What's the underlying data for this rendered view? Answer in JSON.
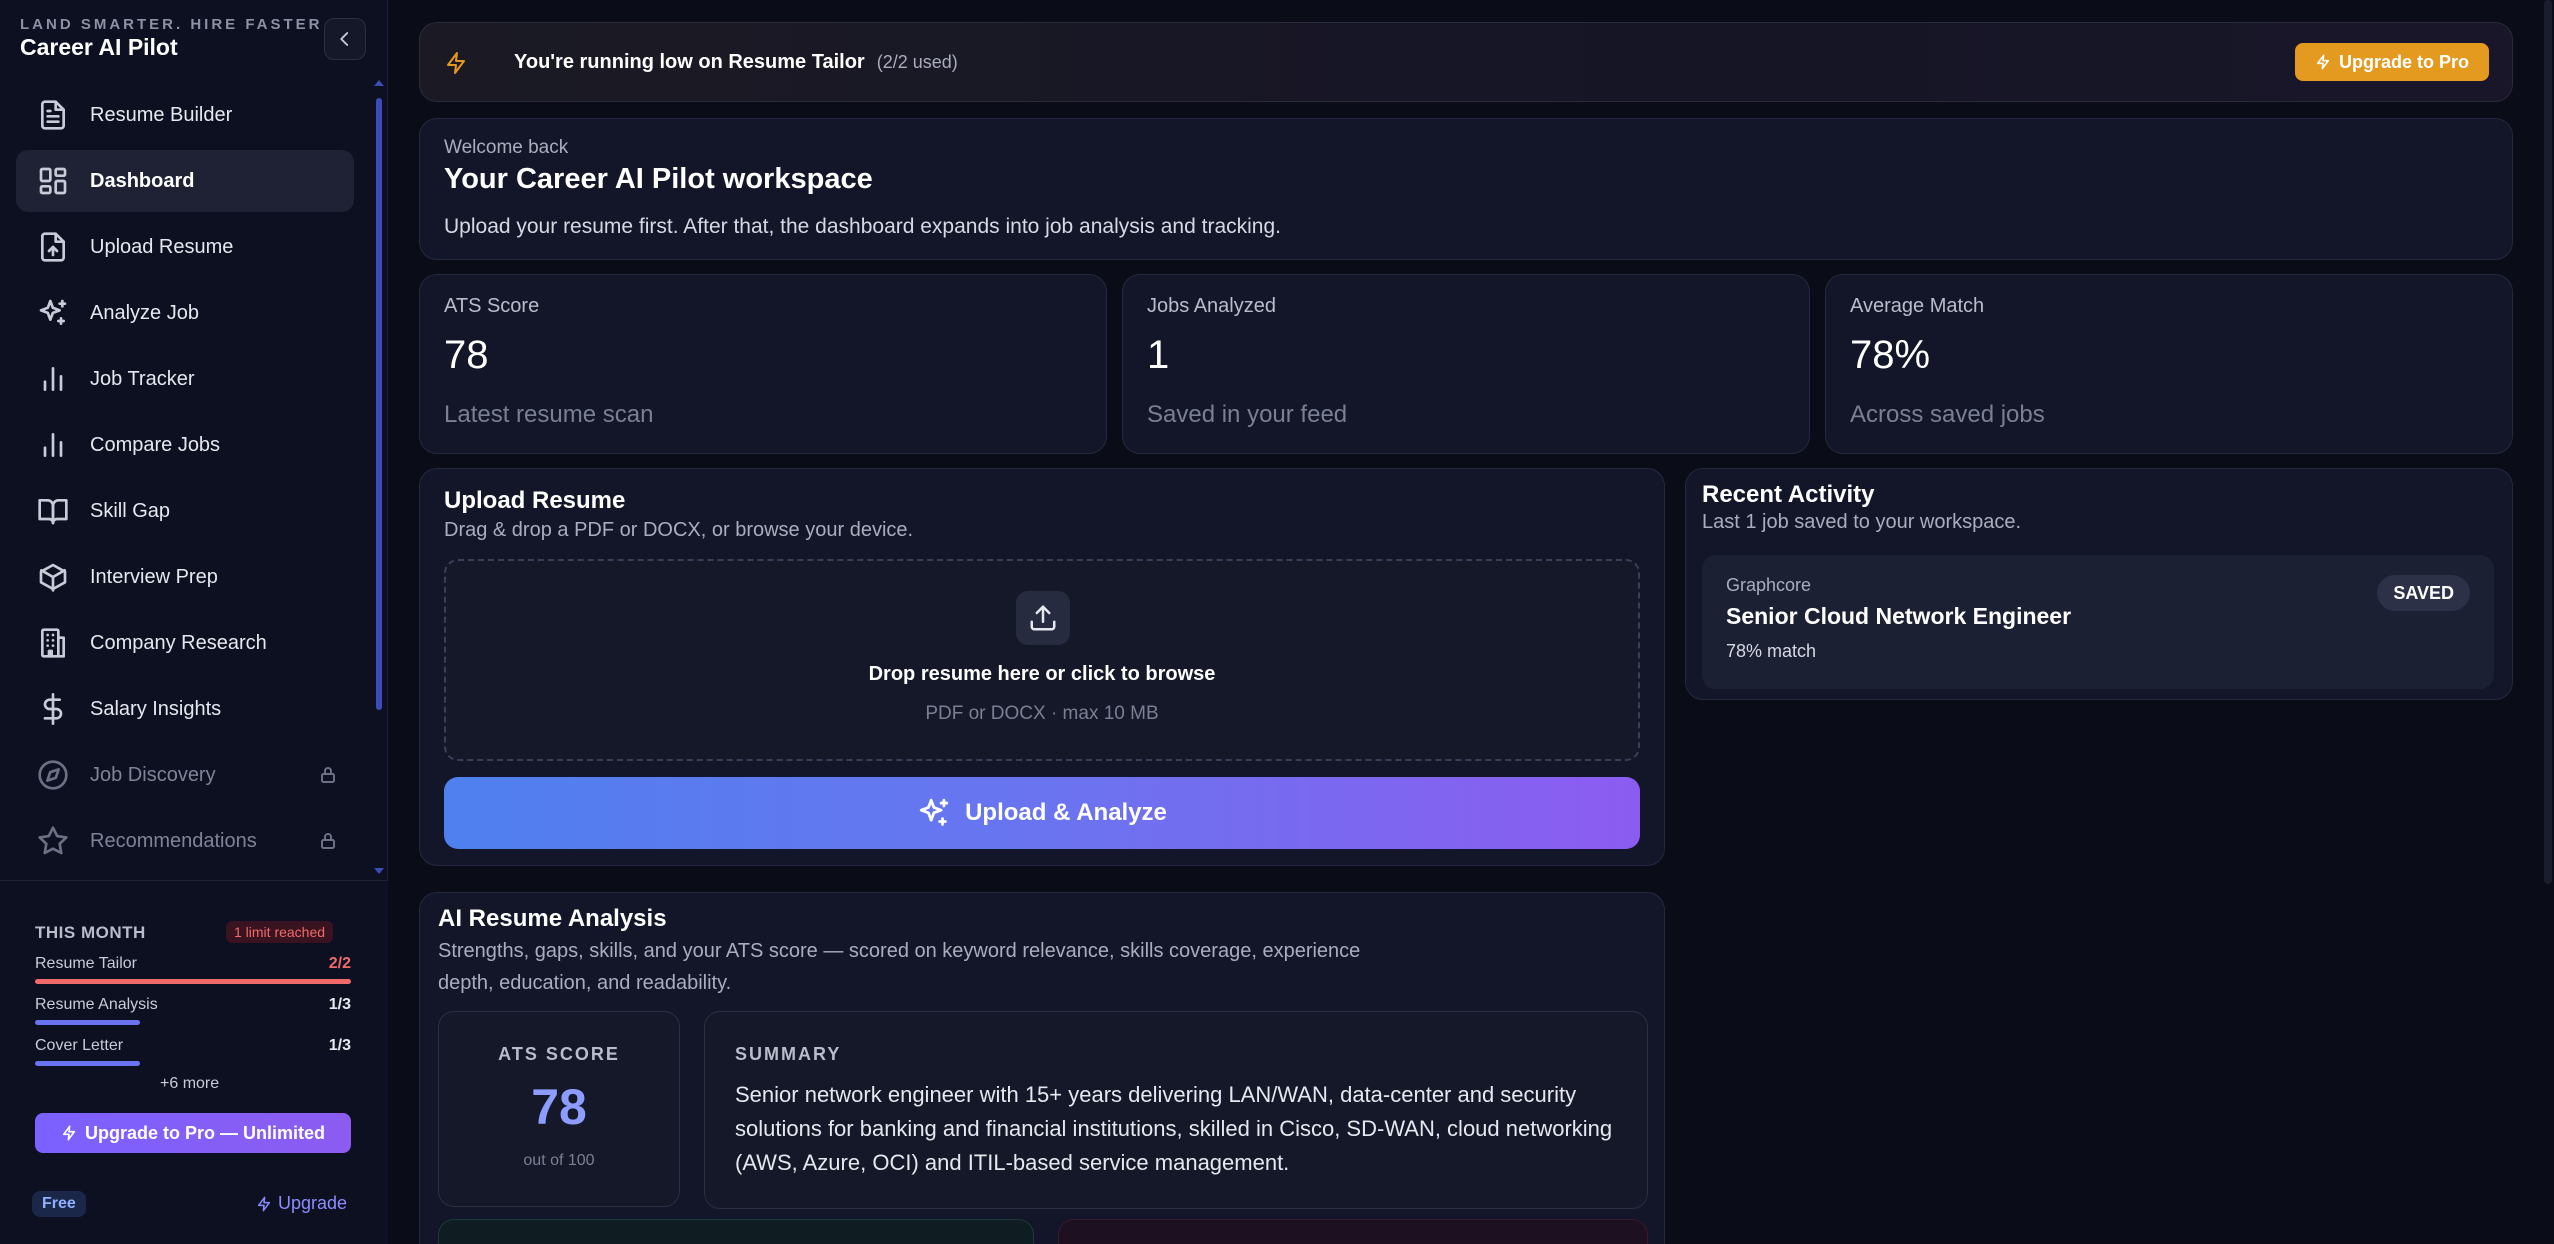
{
  "sidebar": {
    "tagline": "LAND SMARTER. HIRE FASTER",
    "app_name": "Career AI Pilot",
    "items": [
      {
        "label": "Resume Builder",
        "icon": "document-icon"
      },
      {
        "label": "Dashboard",
        "icon": "dashboard-icon"
      },
      {
        "label": "Upload Resume",
        "icon": "upload-file-icon"
      },
      {
        "label": "Analyze Job",
        "icon": "sparkles-icon"
      },
      {
        "label": "Job Tracker",
        "icon": "bar-chart-icon"
      },
      {
        "label": "Compare Jobs",
        "icon": "bar-chart-icon"
      },
      {
        "label": "Skill Gap",
        "icon": "book-icon"
      },
      {
        "label": "Interview Prep",
        "icon": "cube-icon"
      },
      {
        "label": "Company Research",
        "icon": "building-icon"
      },
      {
        "label": "Salary Insights",
        "icon": "dollar-icon"
      },
      {
        "label": "Job Discovery",
        "icon": "compass-icon"
      },
      {
        "label": "Recommendations",
        "icon": "star-icon"
      }
    ],
    "usage": {
      "title": "THIS MONTH",
      "limit_badge": "1 limit reached",
      "rows": [
        {
          "name": "Resume Tailor",
          "value": "2/2",
          "fraction": 1.0
        },
        {
          "name": "Resume Analysis",
          "value": "1/3",
          "fraction": 0.333
        },
        {
          "name": "Cover Letter",
          "value": "1/3",
          "fraction": 0.333
        }
      ],
      "more": "+6 more",
      "upgrade_button": "Upgrade to Pro — Unlimited",
      "plan_badge": "Free",
      "upgrade_link": "Upgrade"
    }
  },
  "banner": {
    "text": "You're running low on Resume Tailor",
    "sub": "(2/2 used)",
    "button": "Upgrade to Pro"
  },
  "welcome": {
    "greeting": "Welcome back",
    "title": "Your Career AI Pilot workspace",
    "description": "Upload your resume first. After that, the dashboard expands into job analysis and tracking."
  },
  "stats": [
    {
      "label": "ATS Score",
      "value": "78",
      "caption": "Latest resume scan"
    },
    {
      "label": "Jobs Analyzed",
      "value": "1",
      "caption": "Saved in your feed"
    },
    {
      "label": "Average Match",
      "value": "78%",
      "caption": "Across saved jobs"
    }
  ],
  "upload": {
    "title": "Upload Resume",
    "subtitle": "Drag & drop a PDF or DOCX, or browse your device.",
    "drop_title": "Drop resume here or click to browse",
    "drop_sub": "PDF or DOCX · max 10 MB",
    "button": "Upload & Analyze"
  },
  "recent": {
    "title": "Recent Activity",
    "subtitle": "Last 1 job saved to your workspace.",
    "job": {
      "company": "Graphcore",
      "title": "Senior Cloud Network Engineer",
      "match": "78% match",
      "badge": "SAVED"
    }
  },
  "analysis": {
    "title": "AI Resume Analysis",
    "subtitle": "Strengths, gaps, skills, and your ATS score — scored on keyword relevance, skills coverage, experience depth, education, and readability.",
    "ats_label": "ATS SCORE",
    "ats_value": "78",
    "ats_out_of": "out of 100",
    "summary_label": "SUMMARY",
    "summary_text": "Senior network engineer with 15+ years delivering LAN/WAN, data-center and security solutions for banking and financial institutions, skilled in Cisco, SD-WAN, cloud networking (AWS, Azure, OCI) and ITIL-based service management."
  },
  "colors": {
    "accent": "#7b61ff",
    "warning": "#e49a1f",
    "danger": "#f06a6a",
    "ats_value": "#8c9cff"
  }
}
